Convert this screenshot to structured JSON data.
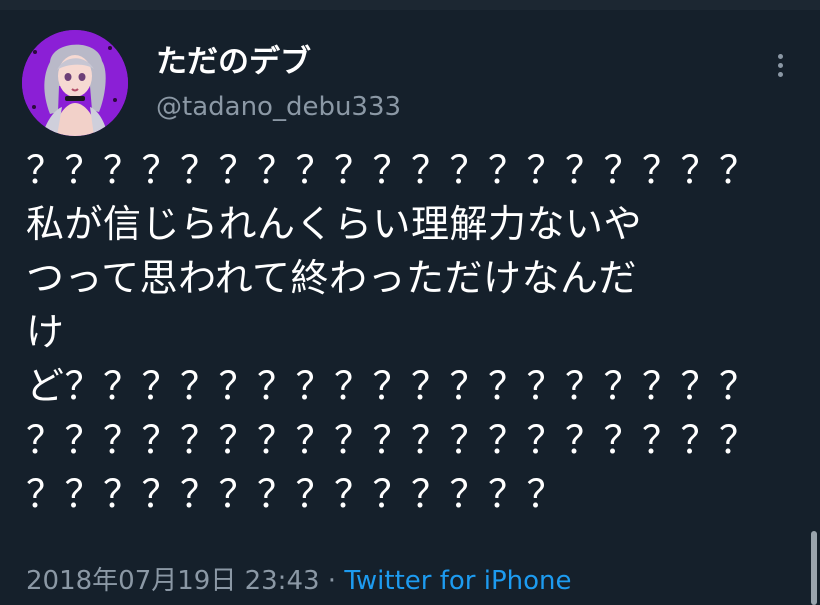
{
  "tweet": {
    "display_name": "ただのデブ",
    "handle": "@tadano_debu333",
    "text_lines": [
      "？？？？？？？？？？？？？？？？？？？",
      "私が信じられんくらい理解力ないや",
      "つって思われて終わっただけなんだ",
      "け",
      "ど？？？？？？？？？？？？？？？？？？",
      "？？？？？？？？？？？？？？？？？？？",
      "？？？？？？？？？？？？？？"
    ],
    "timestamp": "2018年07月19日 23:43",
    "separator": " · ",
    "source": "Twitter for iPhone"
  },
  "icons": {
    "more": "more-vertical-icon",
    "avatar": "anime-avatar"
  },
  "colors": {
    "background": "#15202b",
    "primary_text": "#ffffff",
    "secondary_text": "#8b98a5",
    "link": "#1d9bf0",
    "avatar_bg": "#8b1fd6"
  }
}
